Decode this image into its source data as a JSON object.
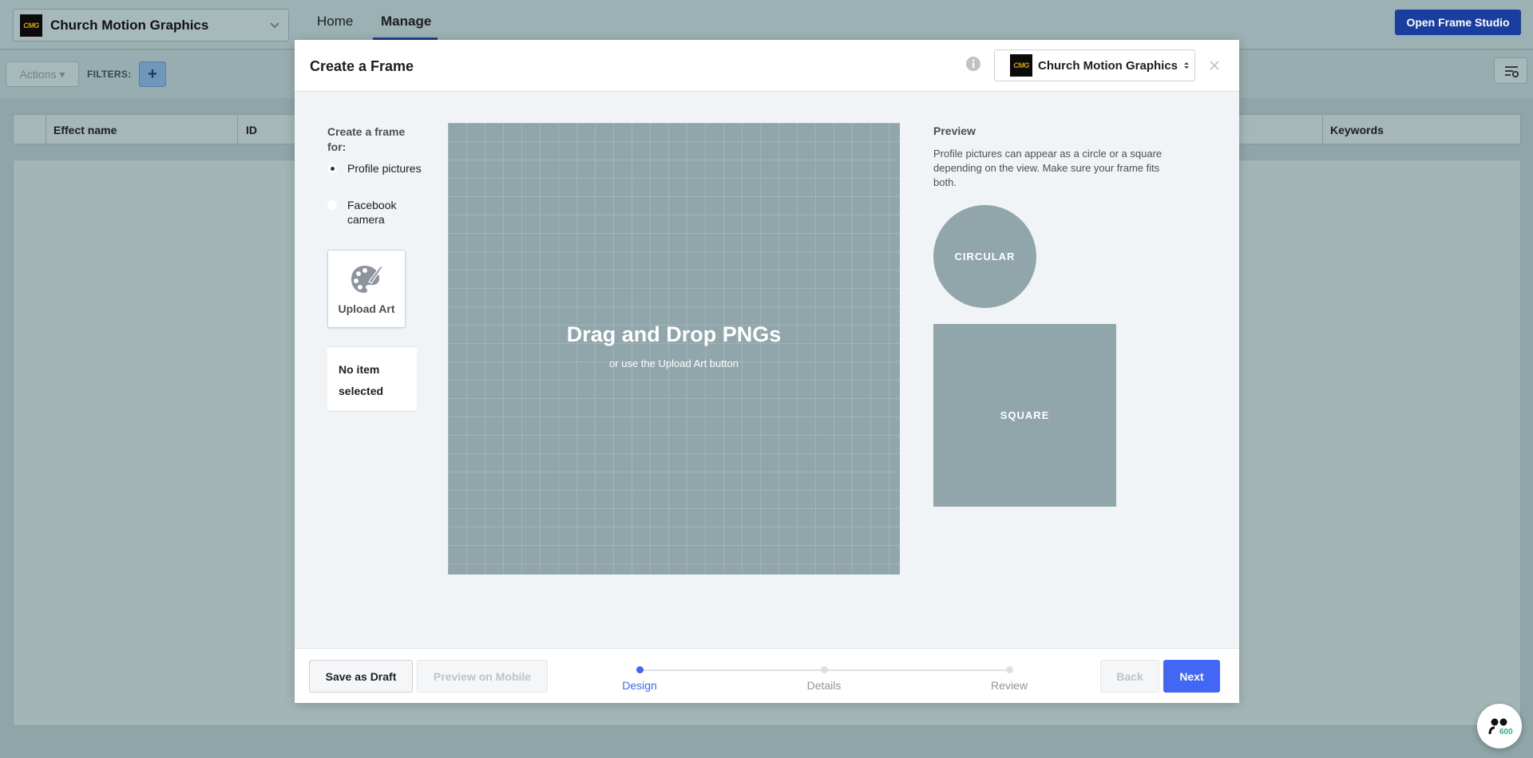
{
  "app": {
    "page_selector": {
      "logo_text": "CMG",
      "name": "Church Motion Graphics"
    },
    "nav": {
      "home": "Home",
      "manage": "Manage"
    },
    "open_studio_label": "Open Frame Studio"
  },
  "toolbar": {
    "actions_label": "Actions ▾",
    "filters_label": "FILTERS:",
    "add_filter_label": "+"
  },
  "table": {
    "columns": [
      "Effect name",
      "ID",
      "Keywords"
    ]
  },
  "modal": {
    "title": "Create a Frame",
    "account": {
      "logo_text": "CMG",
      "name": "Church Motion Graphics"
    },
    "frame_for": {
      "label": "Create a frame for:",
      "options": [
        {
          "label": "Profile pictures",
          "selected": true
        },
        {
          "label": "Facebook camera",
          "selected": false
        }
      ]
    },
    "upload_art_label": "Upload Art",
    "selection_status": "No item selected",
    "canvas": {
      "title": "Drag and Drop PNGs",
      "subtitle": "or use the Upload Art button"
    },
    "preview": {
      "title": "Preview",
      "description": "Profile pictures can appear as a circle or a square depending on the view. Make sure your frame fits both.",
      "circular_label": "CIRCULAR",
      "square_label": "SQUARE"
    },
    "footer": {
      "save_draft_label": "Save as Draft",
      "preview_mobile_label": "Preview on Mobile",
      "back_label": "Back",
      "next_label": "Next",
      "steps": [
        {
          "label": "Design",
          "active": true
        },
        {
          "label": "Details",
          "active": false
        },
        {
          "label": "Review",
          "active": false
        }
      ]
    }
  },
  "colors": {
    "accent": "#4267f5",
    "studio_button": "#1a3ea0",
    "canvas_bg": "#91a6ab"
  }
}
